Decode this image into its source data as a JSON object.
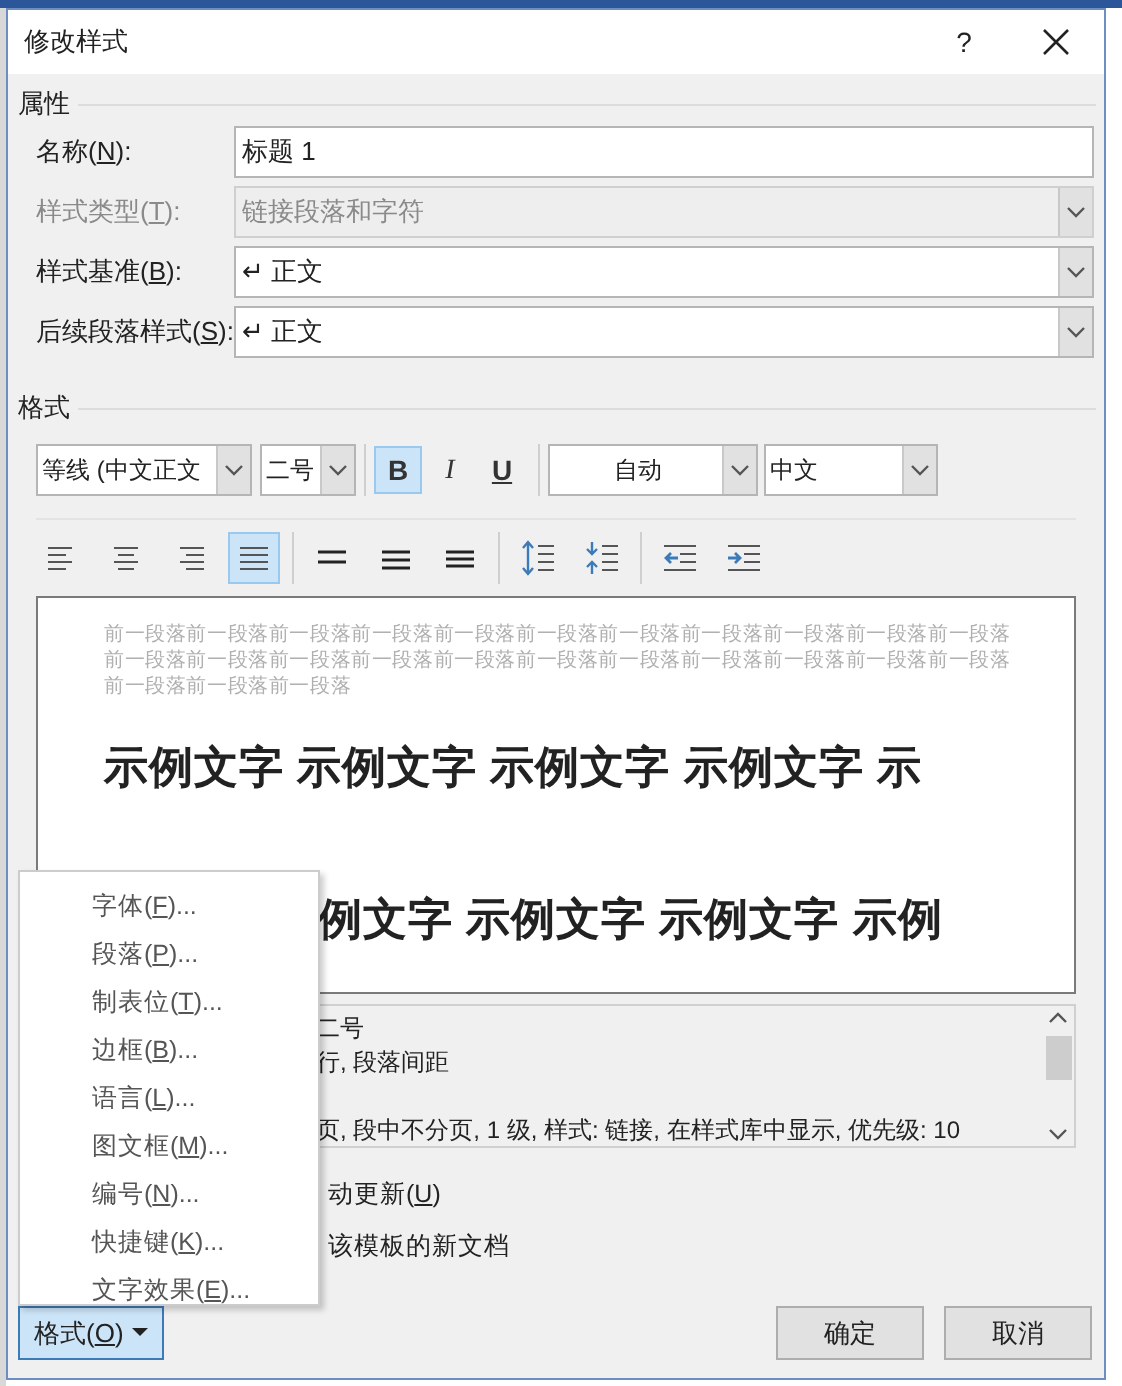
{
  "window": {
    "title": "修改样式",
    "help": "?"
  },
  "properties": {
    "heading": "属性",
    "fields": [
      {
        "label": "名称(N):",
        "value": "标题 1",
        "kind": "text",
        "disabled": false
      },
      {
        "label": "样式类型(T):",
        "value": "链接段落和字符",
        "kind": "combo",
        "disabled": true
      },
      {
        "label": "样式基准(B):",
        "value": "↵ 正文",
        "kind": "combo",
        "disabled": false
      },
      {
        "label": "后续段落样式(S):",
        "value": "↵ 正文",
        "kind": "combo",
        "disabled": false
      }
    ]
  },
  "format": {
    "heading": "格式",
    "font": "等线 (中文正文",
    "size": "二号",
    "styles": [
      {
        "label": "B",
        "selected": true
      },
      {
        "label": "I",
        "selected": false
      },
      {
        "label": "U",
        "selected": false
      }
    ],
    "font_color_setting": "自动",
    "language": "中文",
    "alignment": [
      {
        "kind": "left",
        "selected": false
      },
      {
        "kind": "center",
        "selected": false
      },
      {
        "kind": "right",
        "selected": false
      },
      {
        "kind": "justify",
        "selected": true
      }
    ],
    "line_spacing": [
      {
        "kind": "single",
        "selected": false
      },
      {
        "kind": "onehalf",
        "selected": false
      },
      {
        "kind": "double",
        "selected": false
      }
    ]
  },
  "preview": {
    "previous_paragraph": [
      "前一段落前一段落前一段落前一段落前一段落前一段落前一段落前一段落前一段落前一段落前一段落",
      "前一段落前一段落前一段落前一段落前一段落前一段落前一段落前一段落前一段落前一段落前一段落",
      "前一段落前一段落前一段落"
    ],
    "sample_lines": [
      "示例文字 示例文字 示例文字 示例文字 示",
      "例文字 示例文字 示例文字 示例"
    ]
  },
  "description": [
    "二号",
    "行, 段落间距",
    "页, 段中不分页, 1 级, 样式: 链接, 在样式库中显示, 优先级: 10"
  ],
  "options": [
    "动更新(U)",
    "该模板的新文档"
  ],
  "format_menu": {
    "button": "格式(O)",
    "items": [
      "字体(F)...",
      "段落(P)...",
      "制表位(T)...",
      "边框(B)...",
      "语言(L)...",
      "图文框(M)...",
      "编号(N)...",
      "快捷键(K)...",
      "文字效果(E)..."
    ]
  },
  "buttons": [
    "确定",
    "取消"
  ]
}
